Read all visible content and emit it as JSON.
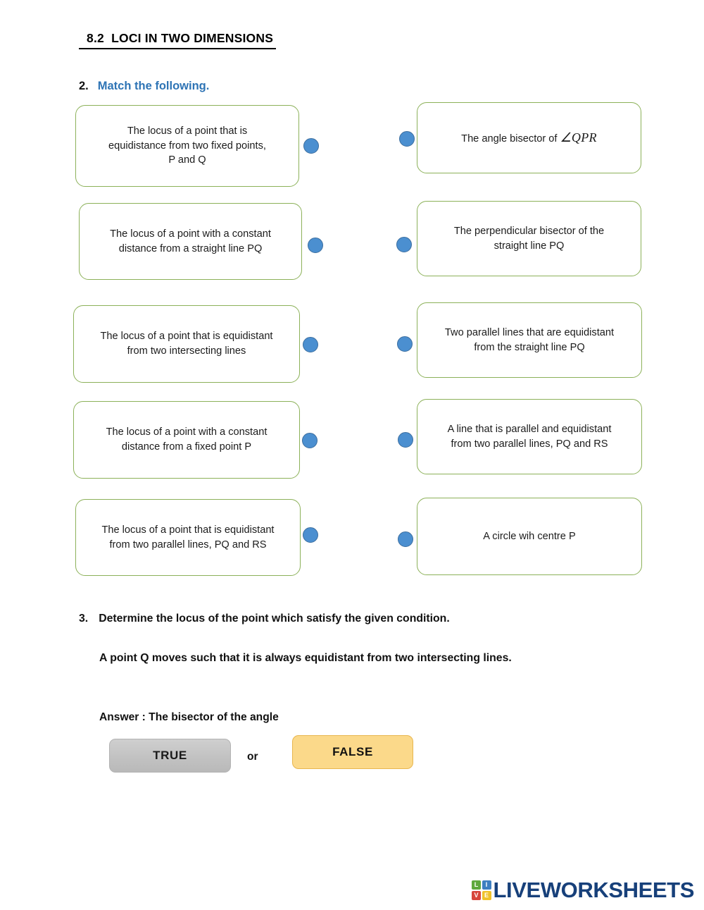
{
  "page": {
    "title": " 8.2  LOCI IN TWO DIMENSIONS",
    "background_color": "#ffffff"
  },
  "colors": {
    "box_border_green": "#8CB159",
    "connector_dot_blue": "#4B8FD0",
    "heading_blue": "#2E74B5",
    "true_button_gray": "#C2C2C2",
    "false_button_amber": "#FBD98A",
    "logo_navy": "#17407A"
  },
  "question2": {
    "number": "2.",
    "instruction": "Match the following.",
    "left_items": [
      {
        "text_line1": "The locus of a point that is",
        "text_line2": "equidistance from two fixed points,",
        "text_line3": "P and  Q"
      },
      {
        "text_line1": "The locus of a point with a constant",
        "text_line2": "distance from a straight line PQ",
        "text_line3": ""
      },
      {
        "text_line1": "The locus of a point that is equidistant",
        "text_line2": "from two intersecting lines",
        "text_line3": ""
      },
      {
        "text_line1": "The locus of a point with a constant",
        "text_line2": "distance from a fixed point P",
        "text_line3": ""
      },
      {
        "text_line1": "The locus of a point that is equidistant",
        "text_line2": "from two parallel lines, PQ and RS",
        "text_line3": ""
      }
    ],
    "right_items": [
      {
        "text_plain": "The angle bisector of ",
        "text_math": "∠QPR",
        "text_line2": ""
      },
      {
        "text_plain": "The perpendicular bisector of the",
        "text_math": "",
        "text_line2": "straight line PQ"
      },
      {
        "text_plain": "Two parallel lines that are equidistant",
        "text_math": "",
        "text_line2": "from the straight line PQ"
      },
      {
        "text_plain": "A line that is parallel and equidistant",
        "text_math": "",
        "text_line2": "from two parallel lines, PQ and RS"
      },
      {
        "text_plain": "A circle wih centre P",
        "text_math": "",
        "text_line2": ""
      }
    ]
  },
  "question3": {
    "number": "3.",
    "instruction": "Determine the locus of the point which satisfy the given condition.",
    "condition": "A point Q moves such that it is always equidistant from two intersecting lines.",
    "answer_label": "Answer : The bisector of the angle",
    "true_label": "TRUE",
    "or_label": "or",
    "false_label": "FALSE"
  },
  "footer": {
    "logo_tiles": [
      "L",
      "I",
      "V",
      "E"
    ],
    "logo_word": "LIVEWORKSHEETS"
  }
}
